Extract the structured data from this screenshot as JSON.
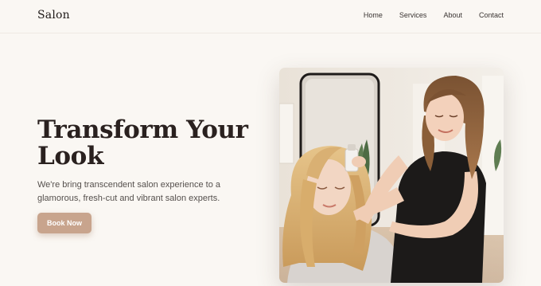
{
  "brand": {
    "name": "Salon"
  },
  "nav": {
    "items": [
      {
        "label": "Home"
      },
      {
        "label": "Services"
      },
      {
        "label": "About"
      },
      {
        "label": "Contact"
      }
    ]
  },
  "hero": {
    "title": "Transform Your Look",
    "subtitle": "We're bring transcendent salon experience to a glamorous, fresh-cut and vibrant salon experts.",
    "cta_label": "Book Now"
  },
  "colors": {
    "background": "#faf7f3",
    "accent": "#c8a48d",
    "heading": "#2a211f"
  }
}
